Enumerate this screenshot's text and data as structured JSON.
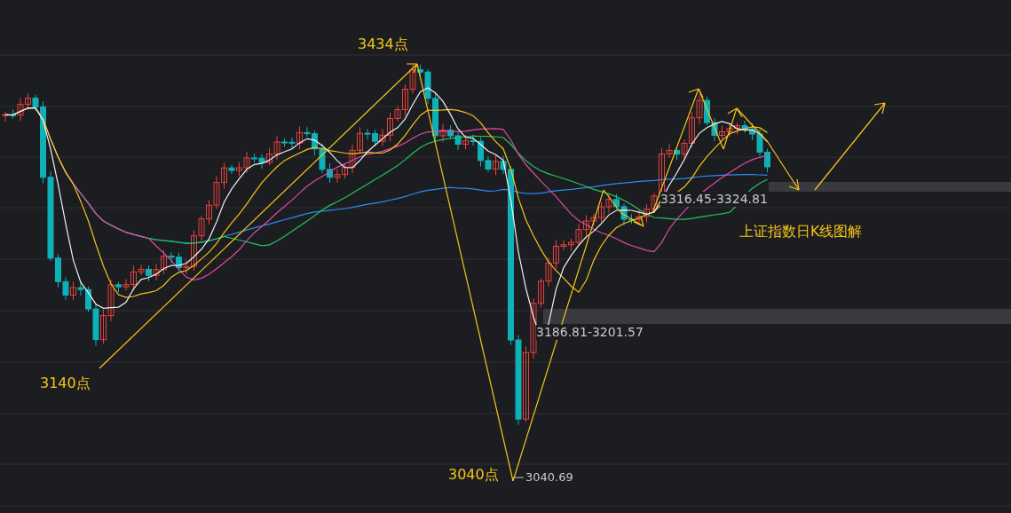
{
  "labels": [
    {
      "kind": "point",
      "text": "3434点"
    },
    {
      "kind": "point",
      "text": "3140点"
    },
    {
      "kind": "point",
      "text": "3040点"
    },
    {
      "kind": "range",
      "text": "3316.45-3324.81"
    },
    {
      "kind": "range",
      "text": "3186.81-3201.57"
    },
    {
      "kind": "value",
      "text": "3040.69"
    },
    {
      "kind": "caption",
      "text": "上证指数日K线图解"
    }
  ]
}
